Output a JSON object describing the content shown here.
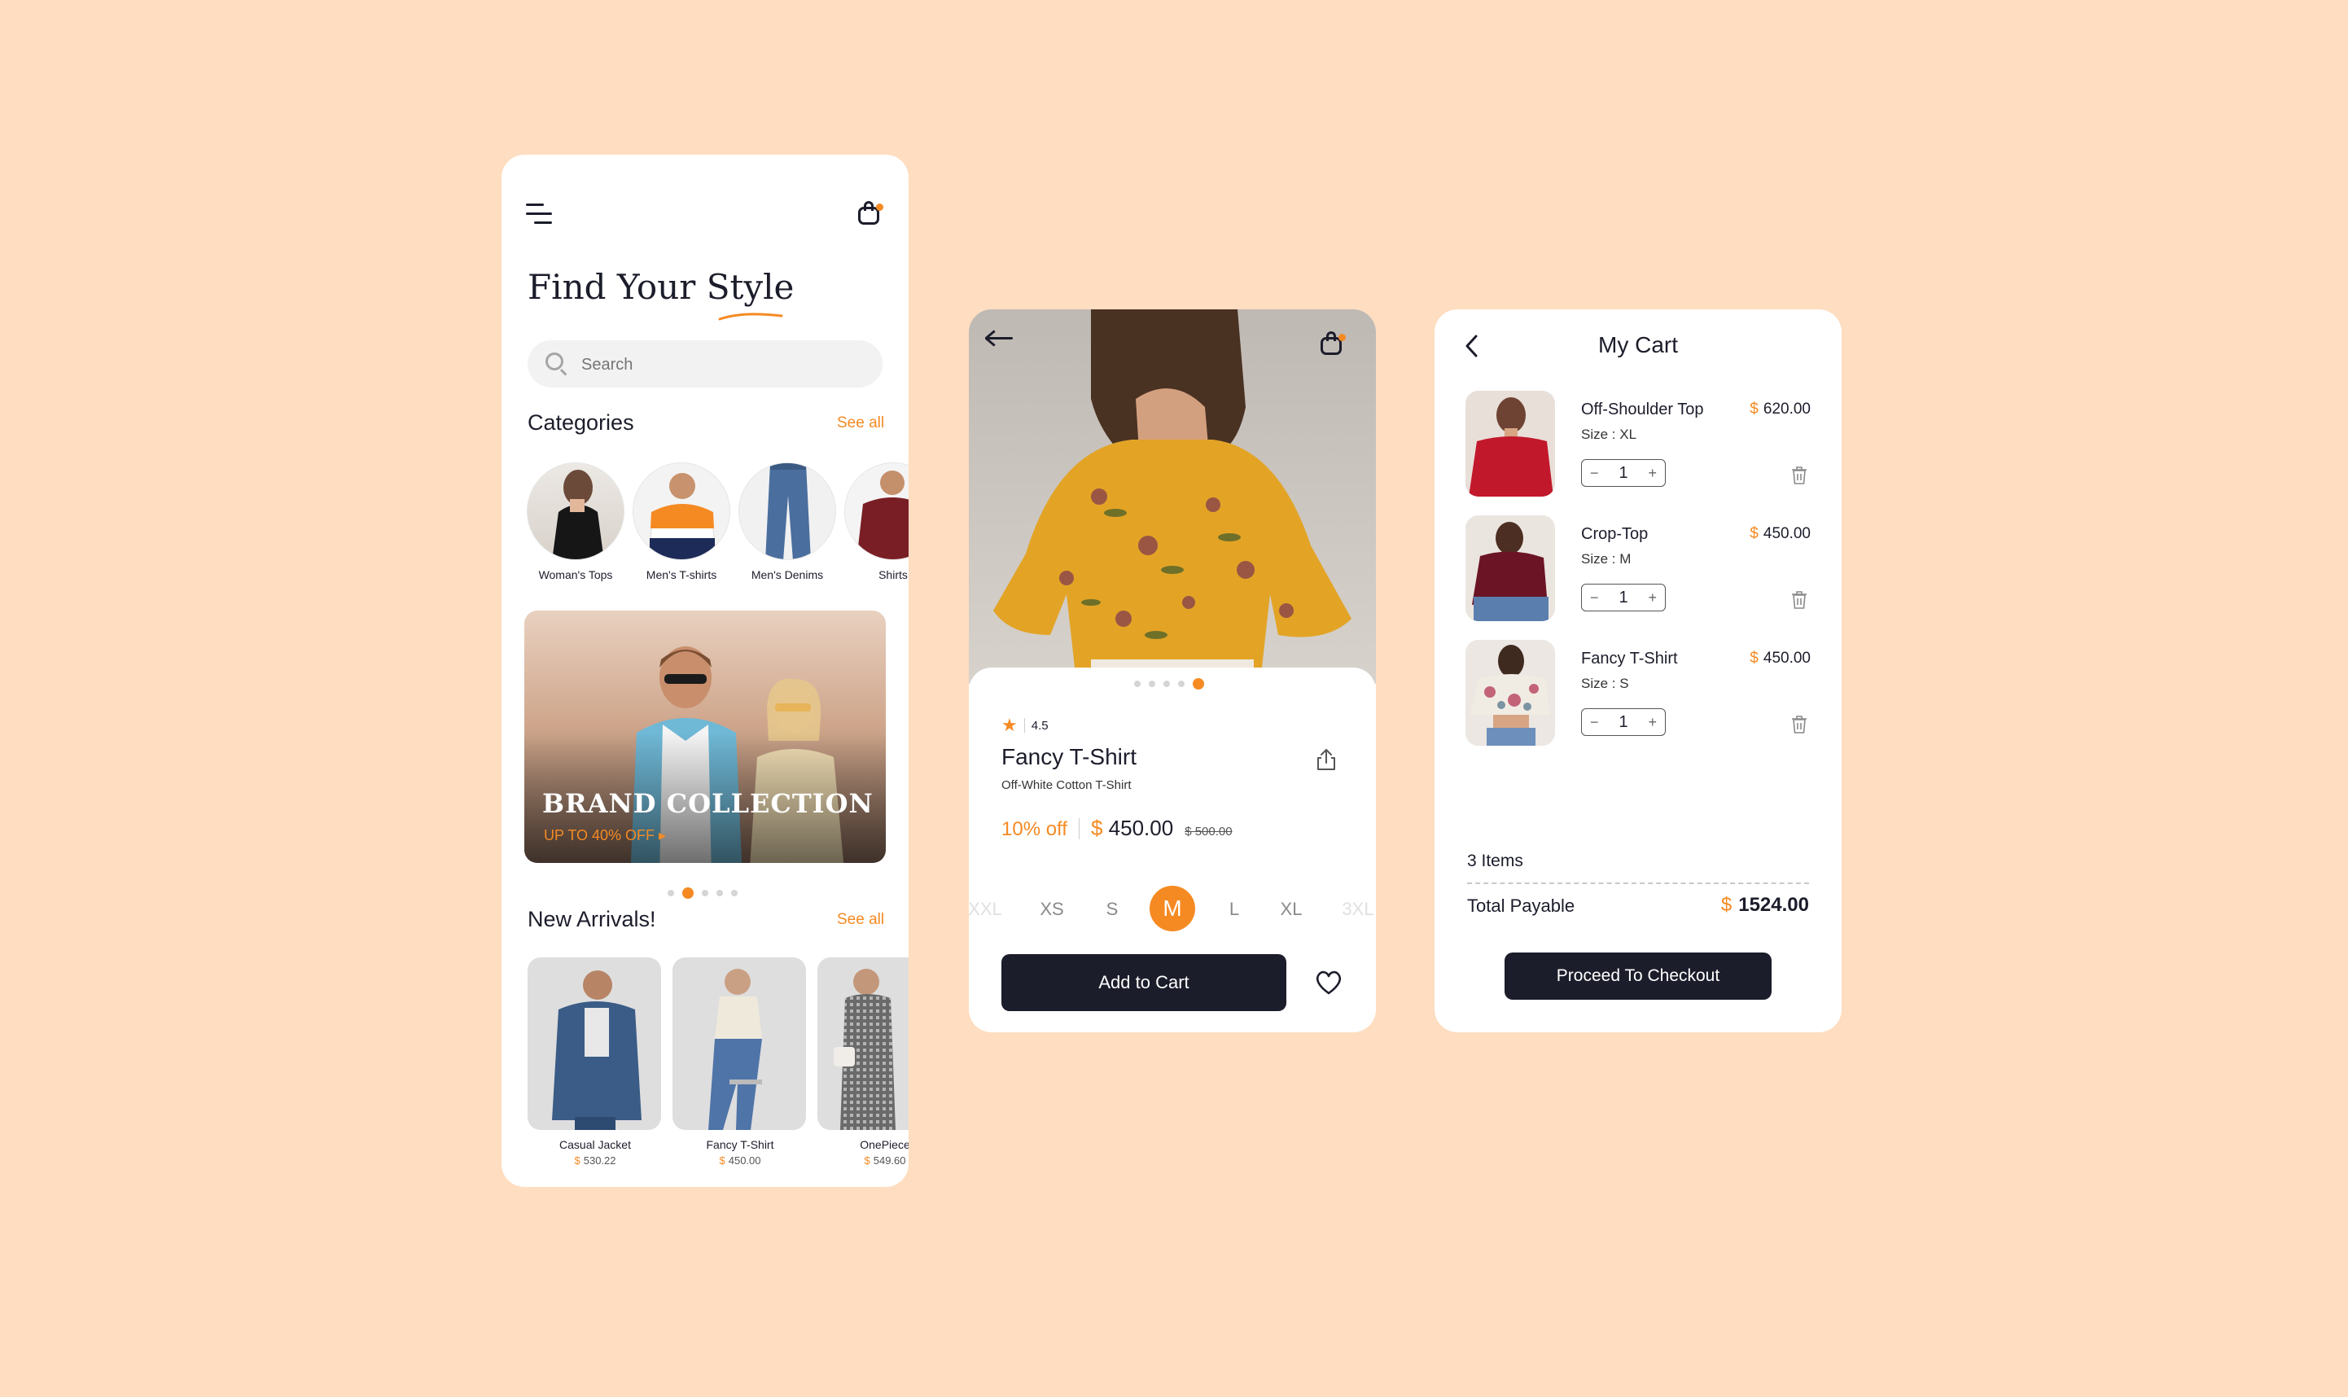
{
  "colors": {
    "background": "#FEDDC0",
    "accent": "#F58A23",
    "dark": "#1C1D2B"
  },
  "home": {
    "title": "Find Your Style",
    "search_placeholder": "Search",
    "categories_title": "Categories",
    "categories_see_all": "See all",
    "categories": [
      {
        "label": "Woman's Tops"
      },
      {
        "label": "Men's T-shirts"
      },
      {
        "label": "Men's Denims"
      },
      {
        "label": "Shirts"
      }
    ],
    "banner": {
      "title": "BRAND COLLECTION",
      "subtitle": "UP TO 40% OFF"
    },
    "arrivals_title": "New Arrivals!",
    "arrivals_see_all": "See all",
    "arrivals": [
      {
        "name": "Casual Jacket",
        "currency": "$",
        "price": "530.22"
      },
      {
        "name": "Fancy T-Shirt",
        "currency": "$",
        "price": "450.00"
      },
      {
        "name": "OnePiece",
        "currency": "$",
        "price": "549.60"
      }
    ]
  },
  "product": {
    "rating": "4.5",
    "name": "Fancy T-Shirt",
    "subtitle": "Off-White Cotton T-Shirt",
    "discount": "10% off",
    "currency": "$",
    "price": "450.00",
    "old_price": "$ 500.00",
    "sizes": [
      "XXL",
      "XS",
      "S",
      "M",
      "L",
      "XL",
      "3XL"
    ],
    "selected_size": "M",
    "add_to_cart": "Add to Cart"
  },
  "cart": {
    "title": "My Cart",
    "items": [
      {
        "name": "Off-Shoulder Top",
        "size": "Size : XL",
        "qty": "1",
        "currency": "$",
        "price": "620.00"
      },
      {
        "name": "Crop-Top",
        "size": "Size : M",
        "qty": "1",
        "currency": "$",
        "price": "450.00"
      },
      {
        "name": "Fancy T-Shirt",
        "size": "Size : S",
        "qty": "1",
        "currency": "$",
        "price": "450.00"
      }
    ],
    "items_count": "3 Items",
    "total_label": "Total Payable",
    "total_currency": "$",
    "total_value": "1524.00",
    "checkout": "Proceed To Checkout"
  },
  "icons": [
    "menu-icon",
    "shopping-bag-icon",
    "search-icon",
    "back-arrow-icon",
    "star-icon",
    "share-icon",
    "heart-icon",
    "chevron-left-icon",
    "trash-icon"
  ]
}
